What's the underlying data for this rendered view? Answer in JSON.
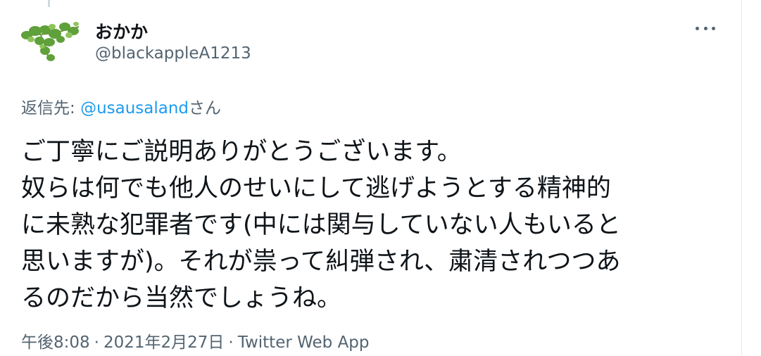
{
  "author": {
    "display_name": "おかか",
    "handle": "@blackappleA1213",
    "avatar_icon": "ivy-leaf-avatar"
  },
  "reply": {
    "prefix": "返信先: ",
    "mention": "@usausaland",
    "suffix": "さん"
  },
  "tweet": {
    "line1": "ご丁寧にご説明ありがとうございます。",
    "line2": "奴らは何でも他人のせいにして逃げようとする精神的",
    "line3_marked": "に未熟な犯罪者です",
    "line3_rest": "(中には関与していない人もいると",
    "line4_plain": "思いますが)。",
    "line4_marked": "それが祟って糾弾され、粛清されつつあ",
    "line5": "るのだから当然でしょうね。"
  },
  "meta": {
    "time": "午後8:08",
    "separator": "·",
    "date": "2021年2月27日",
    "source": "Twitter Web App"
  },
  "colors": {
    "highlight": "#ffdd00",
    "link": "#1d9bf0",
    "secondary_text": "#536471",
    "primary_text": "#0f1419"
  }
}
